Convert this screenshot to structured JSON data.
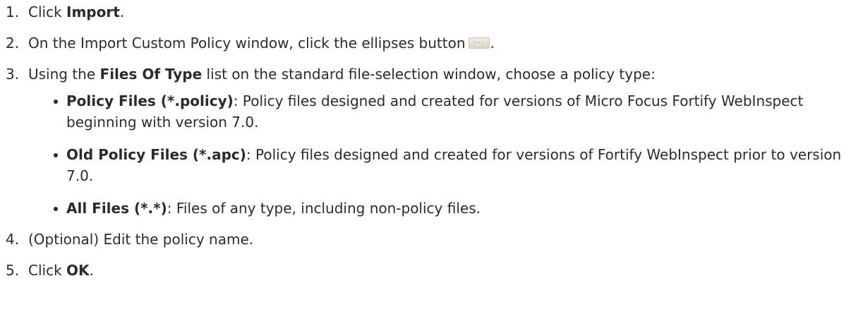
{
  "steps": [
    {
      "num": "1.",
      "pre": "Click ",
      "bold": "Import",
      "post": "."
    },
    {
      "num": "2.",
      "text": "On the Import Custom Policy window, click the ellipses button",
      "button_glyph": "...",
      "post": "."
    },
    {
      "num": "3.",
      "pre": "Using the ",
      "bold": "Files Of Type",
      "post": " list on the standard file-selection window, choose a policy type:"
    },
    {
      "num": "4.",
      "text": "(Optional) Edit the policy name."
    },
    {
      "num": "5.",
      "pre": "Click ",
      "bold": "OK",
      "post": "."
    }
  ],
  "file_types": [
    {
      "label": "Policy Files (*.policy)",
      "desc": ": Policy files designed and created for versions of Micro Focus Fortify WebInspect beginning with version 7.0."
    },
    {
      "label": "Old Policy Files (*.apc)",
      "desc": ": Policy files designed and created for versions of Fortify WebInspect prior to version 7.0."
    },
    {
      "label": "All Files (*.*)",
      "desc": ": Files of any type, including non-policy files."
    }
  ]
}
